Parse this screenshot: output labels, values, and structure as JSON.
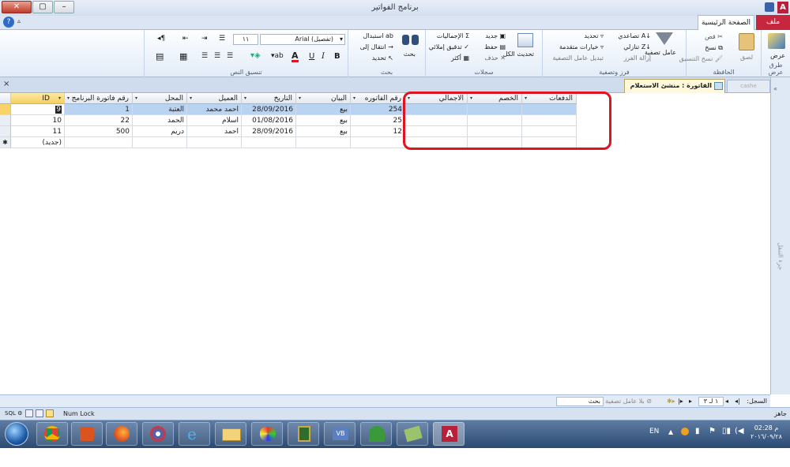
{
  "window": {
    "title": "برنامج الفواتير",
    "app_icon": "A"
  },
  "ribbon_tabs": {
    "file": "ملف",
    "home": "الصفحة الرئيسية"
  },
  "groups": {
    "views": {
      "label": "طرق عرض",
      "view": "عرض"
    },
    "clipboard": {
      "label": "الحافظة",
      "paste": "لصق",
      "cut": "قص",
      "copy": "نسخ",
      "format_painter": "نسخ التنسيق"
    },
    "sort_filter": {
      "label": "فرز وتصفية",
      "filter": "عامل تصفية",
      "ascending": "تصاعدي",
      "descending": "تنازلي",
      "clear_sort": "إزالة الفرز",
      "selection": "تحديد",
      "advanced": "خيارات متقدمة",
      "toggle": "تبديل عامل التصفية"
    },
    "records": {
      "label": "سجلات",
      "refresh": "تحديث الكل",
      "new": "جديد",
      "save": "حفظ",
      "delete": "حذف",
      "totals": "الإجماليات",
      "spelling": "تدقيق إملائي",
      "more": "أكثر"
    },
    "find": {
      "label": "بحث",
      "find": "بحث",
      "replace": "استبدال",
      "goto": "انتقال إلى",
      "select": "تحديد"
    },
    "text_format": {
      "label": "تنسيق النص",
      "font": "Arial (تفصيل)",
      "size": "١١"
    }
  },
  "doc_tabs": {
    "active": "الفاتورة : منشئ الاستعلام",
    "other": "cashe"
  },
  "grid": {
    "headers": [
      "ID",
      "رقم فاتورة البرنامج",
      "المحل",
      "العميل",
      "التاريخ",
      "البيان",
      "رقم الفاتوره",
      "الاجمالي",
      "الخصم",
      "الدفعات"
    ],
    "rows": [
      {
        "id": "9",
        "prog_no": "1",
        "shop": "العتبة",
        "client": "احمد محمد",
        "date": "28/09/2016",
        "desc": "بيع",
        "inv_no": "254"
      },
      {
        "id": "10",
        "prog_no": "22",
        "shop": "الحمد",
        "client": "اسلام",
        "date": "01/08/2016",
        "desc": "بيع",
        "inv_no": "25"
      },
      {
        "id": "11",
        "prog_no": "500",
        "shop": "دريم",
        "client": "احمد",
        "date": "28/09/2016",
        "desc": "بيع",
        "inv_no": "12"
      }
    ],
    "new_row": "(جديد)"
  },
  "right_pane": {
    "label": "جزء التنقل"
  },
  "record_nav": {
    "label": "السجل:",
    "position": "١ لـ ٣",
    "filter_status": "بلا عامل تصفية",
    "search": "بحث"
  },
  "statusbar": {
    "ready": "جاهز",
    "numlock": "Num Lock",
    "sql": "SQL"
  },
  "taskbar": {
    "lang": "EN",
    "time": "02:28 م",
    "date": "٢٠١٦/٠٩/٢٨"
  },
  "colors": {
    "highlight": "#e0141e",
    "file_tab": "#c6263e",
    "selected_row": "#b9d3f2"
  }
}
